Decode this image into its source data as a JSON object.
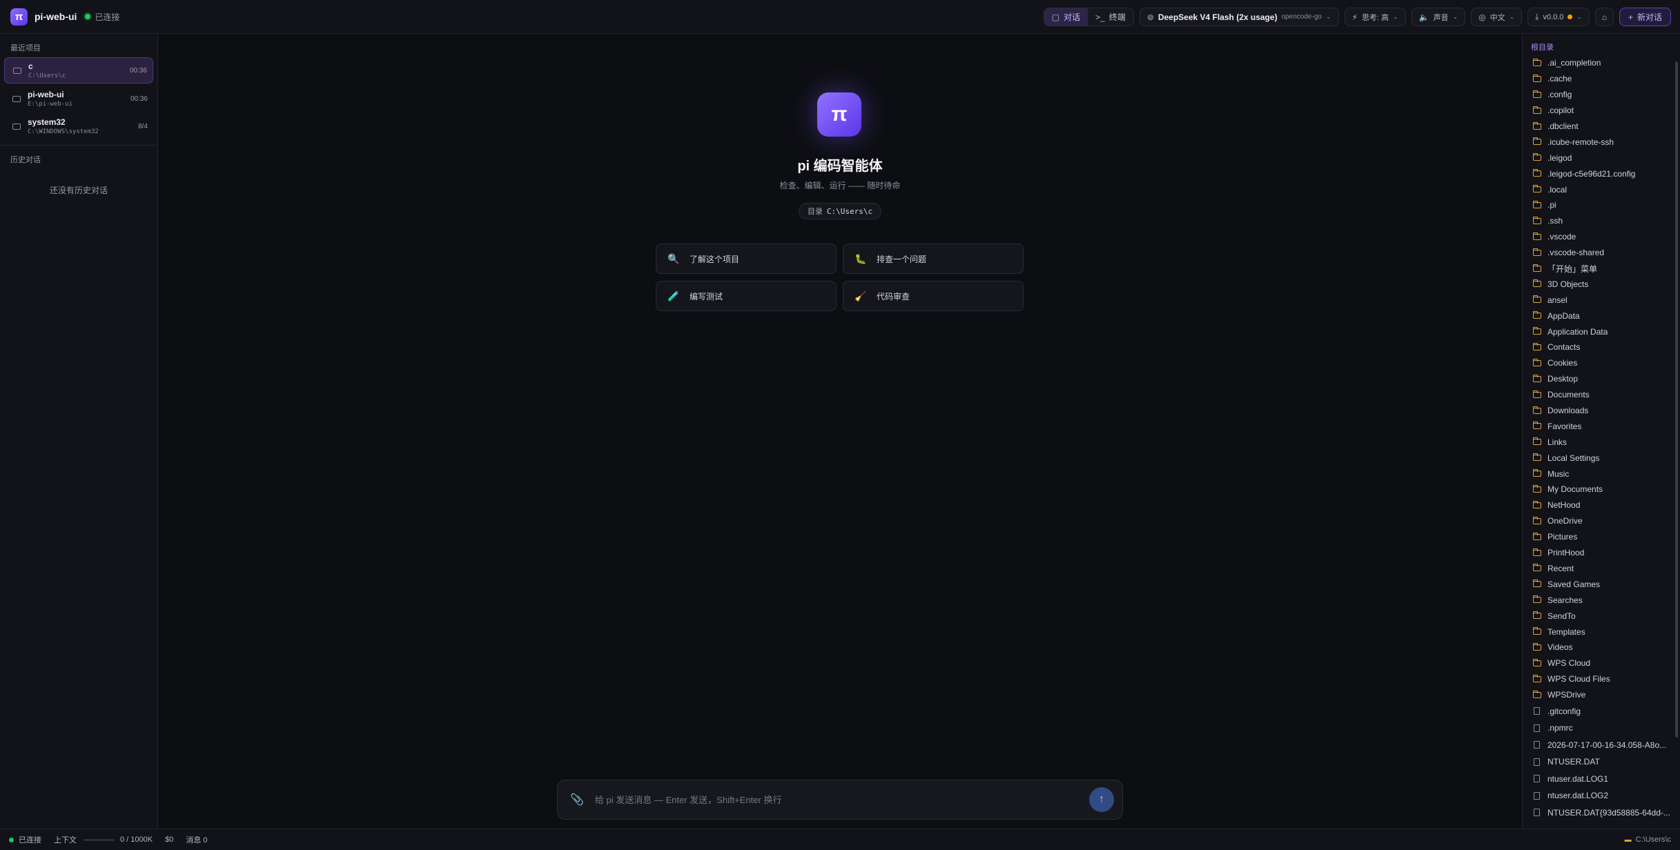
{
  "header": {
    "logo_glyph": "π",
    "app_title": "pi-web-ui",
    "status": "已连接",
    "tabs": [
      {
        "icon": "chat-icon",
        "glyph": "▢",
        "label": "对话",
        "active": true
      },
      {
        "icon": "terminal-icon",
        "glyph": ">_",
        "label": "终端",
        "active": false
      }
    ],
    "model": {
      "name": "DeepSeek V4 Flash (2x usage)",
      "provider": "opencode-go"
    },
    "thinking": "思考: 高",
    "sound": "声音",
    "language": "中文",
    "version": "v0.0.0",
    "new_chat": "新对话"
  },
  "left_sidebar": {
    "recent_label": "最近项目",
    "projects": [
      {
        "name": "c",
        "path": "C:\\Users\\c",
        "time": "00:36",
        "active": true
      },
      {
        "name": "pi-web-ui",
        "path": "E:\\pi-web-ui",
        "time": "00:36",
        "active": false
      },
      {
        "name": "system32",
        "path": "C:\\WINDOWS\\system32",
        "time": "8/4",
        "active": false
      }
    ],
    "history_label": "历史对话",
    "history_empty": "还没有历史对话"
  },
  "main": {
    "logo_glyph": "π",
    "title": "pi 编码智能体",
    "subtitle": "检查、编辑、运行 —— 随时待命",
    "dir_label": "目录",
    "dir_path": "C:\\Users\\c",
    "suggestions": [
      {
        "emoji": "🔍",
        "icon": "magnifier-icon",
        "label": "了解这个项目"
      },
      {
        "emoji": "🐛",
        "icon": "bug-icon",
        "label": "排查一个问题"
      },
      {
        "emoji": "🧪",
        "icon": "test-tube-icon",
        "label": "编写测试"
      },
      {
        "emoji": "🧹",
        "icon": "broom-icon",
        "label": "代码审查"
      }
    ],
    "composer_placeholder": "给 pi 发送消息 — Enter 发送，Shift+Enter 换行"
  },
  "right_sidebar": {
    "root_label": "根目录",
    "folders": [
      ".ai_completion",
      ".cache",
      ".config",
      ".copilot",
      ".dbclient",
      ".icube-remote-ssh",
      ".leigod",
      ".leigod-c5e96d21.config",
      ".local",
      ".pi",
      ".ssh",
      ".vscode",
      ".vscode-shared",
      "「开始」菜单",
      "3D Objects",
      "ansel",
      "AppData",
      "Application Data",
      "Contacts",
      "Cookies",
      "Desktop",
      "Documents",
      "Downloads",
      "Favorites",
      "Links",
      "Local Settings",
      "Music",
      "My Documents",
      "NetHood",
      "OneDrive",
      "Pictures",
      "PrintHood",
      "Recent",
      "Saved Games",
      "Searches",
      "SendTo",
      "Templates",
      "Videos",
      "WPS Cloud",
      "WPS Cloud Files",
      "WPSDrive"
    ],
    "files": [
      ".gitconfig",
      ".npmrc",
      "2026-07-17-00-16-34.058-A8o...",
      "NTUSER.DAT",
      "ntuser.dat.LOG1",
      "ntuser.dat.LOG2",
      "NTUSER.DAT{93d58885-64dd-..."
    ]
  },
  "statusbar": {
    "status": "已连接",
    "context_label": "上下文",
    "context_value": "0 / 1000K",
    "cost": "$0",
    "messages": "消息 0",
    "cwd": "C:\\Users\\c"
  },
  "colors": {
    "accent": "#8b5cf6",
    "online": "#22c55e",
    "folder": "#e0a33c",
    "background": "#0d0e12"
  }
}
